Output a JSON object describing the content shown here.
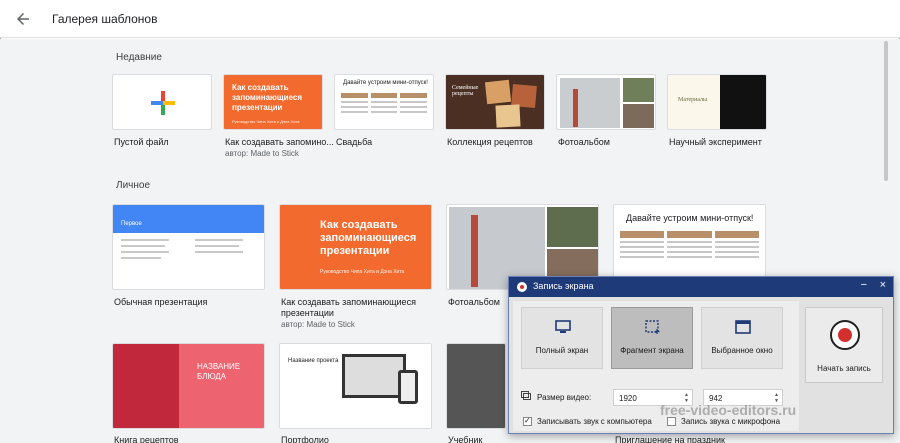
{
  "header": {
    "title": "Галерея шаблонов"
  },
  "sections": {
    "recent": "Недавние",
    "personal": "Личное"
  },
  "recent_templates": [
    {
      "label": "Пустой файл",
      "sub": ""
    },
    {
      "label": "Как создавать запомино...",
      "sub": "автор: Made to Stick",
      "thumb_title": "Как создавать запоминающиеся презентации",
      "thumb_sub": "Руководство Чипа Хита и Дэна Хита"
    },
    {
      "label": "Свадьба",
      "sub": "",
      "thumb_title": "Давайте устроим мини-отпуск!"
    },
    {
      "label": "Коллекция рецептов",
      "sub": "",
      "thumb_title": "Семейные рецепты"
    },
    {
      "label": "Фотоальбом",
      "sub": ""
    },
    {
      "label": "Научный эксперимент",
      "sub": "",
      "thumb_title": "Материалы"
    }
  ],
  "personal_templates": [
    {
      "label": "Обычная презентация",
      "sub": "",
      "thumb_title": "Первое"
    },
    {
      "label": "Как создавать запоминающиеся",
      "label2": "презентации",
      "sub": "автор: Made to Stick",
      "thumb_title": "Как создавать запоминающиеся презентации",
      "thumb_sub": "Руководство Чипа Хита и Дэна Хита"
    },
    {
      "label": "Фотоальбом",
      "sub": ""
    },
    {
      "label": "",
      "sub": "",
      "thumb_title": "Давайте устроим мини-отпуск!"
    }
  ],
  "bottom_templates": [
    {
      "label": "Книга рецептов",
      "thumb_title": "НАЗВАНИЕ БЛЮДА"
    },
    {
      "label": "Портфолио",
      "thumb_title": "Название проекта"
    },
    {
      "label": "Учебник"
    },
    {
      "label": "Приглашение на праздник"
    }
  ],
  "recorder": {
    "title": "Запись экрана",
    "minimize": "−",
    "close": "×",
    "modes": [
      "Полный экран",
      "Фрагмент экрана",
      "Выбранное окно"
    ],
    "selected_mode": "Фрагмент экрана",
    "size_label": "Размер видео:",
    "width": "1920",
    "height": "942",
    "audio_computer": "Записывать звук с компьютера",
    "audio_computer_checked": true,
    "audio_mic": "Запись звука с микрофона",
    "audio_mic_checked": false,
    "start": "Начать запись"
  },
  "watermark": "free-video-editors.ru"
}
